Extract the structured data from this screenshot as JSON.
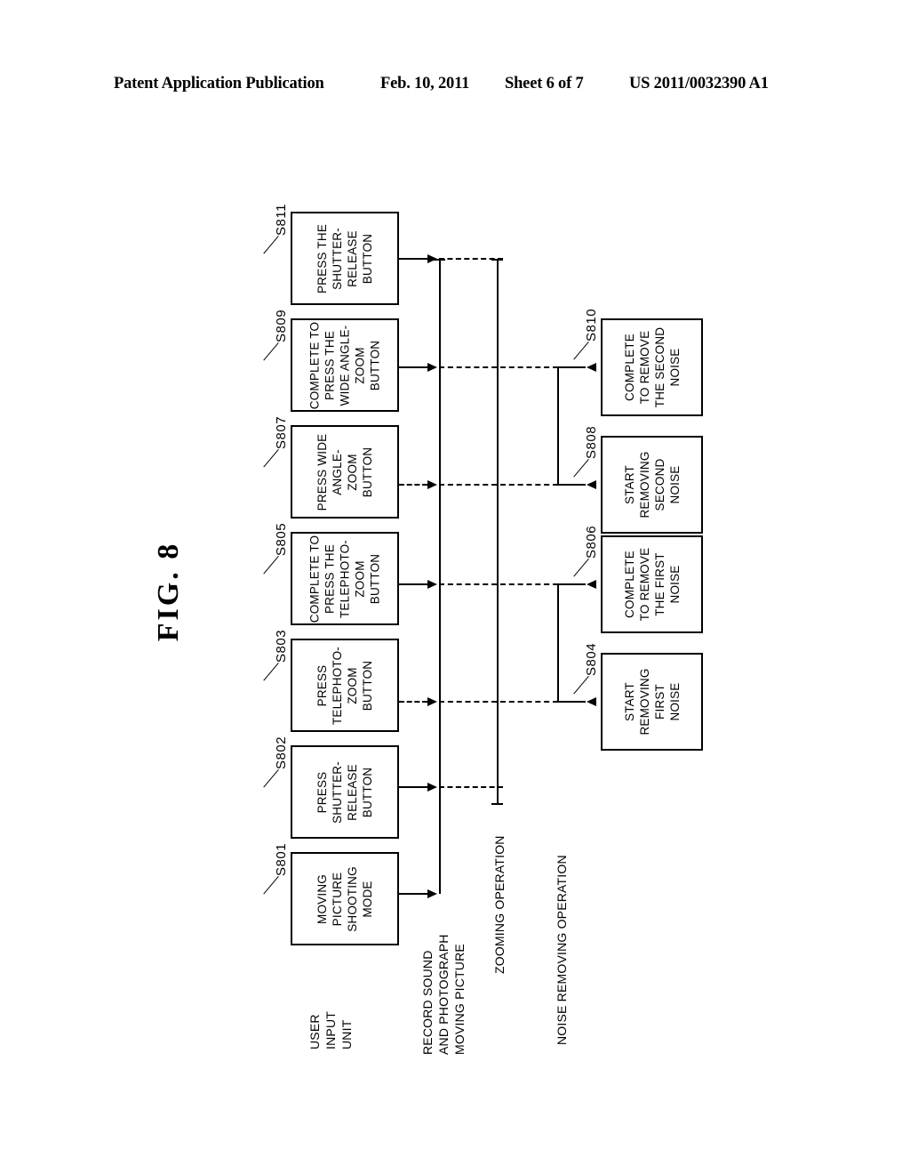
{
  "header": {
    "publication": "Patent Application Publication",
    "date": "Feb. 10, 2011",
    "sheet": "Sheet 6 of 7",
    "patent_number": "US 2011/0032390 A1"
  },
  "figure": {
    "title": "FIG.  8"
  },
  "diagram": {
    "lane_labels": [
      {
        "id": "user-input-unit",
        "text": "USER\nINPUT\nUNIT"
      },
      {
        "id": "record-sound",
        "text": "RECORD SOUND\nAND PHOTOGRAPH\nMOVING PICTURE"
      },
      {
        "id": "zooming-operation",
        "text": "ZOOMING OPERATION"
      },
      {
        "id": "noise-removing-operation",
        "text": "NOISE REMOVING OPERATION"
      }
    ],
    "left_nodes": [
      {
        "ref": "S801",
        "text": "MOVING\nPICTURE\nSHOOTING\nMODE"
      },
      {
        "ref": "S802",
        "text": "PRESS\nSHUTTER-\nRELEASE\nBUTTON"
      },
      {
        "ref": "S803",
        "text": "PRESS\nTELEPHOTO-\nZOOM\nBUTTON"
      },
      {
        "ref": "S805",
        "text": "COMPLETE TO\nPRESS THE\nTELEPHOTO-\nZOOM\nBUTTON"
      },
      {
        "ref": "S807",
        "text": "PRESS WIDE\nANGLE-\nZOOM\nBUTTON"
      },
      {
        "ref": "S809",
        "text": "COMPLETE TO\nPRESS THE\nWIDE ANGLE-\nZOOM\nBUTTON"
      },
      {
        "ref": "S811",
        "text": "PRESS THE\nSHUTTER-\nRELEASE\nBUTTON"
      }
    ],
    "right_nodes": [
      {
        "ref": "S804",
        "text": "START\nREMOVING\nFIRST\nNOISE"
      },
      {
        "ref": "S806",
        "text": "COMPLETE\nTO REMOVE\nTHE FIRST\nNOISE"
      },
      {
        "ref": "S808",
        "text": "START\nREMOVING\nSECOND\nNOISE"
      },
      {
        "ref": "S810",
        "text": "COMPLETE\nTO REMOVE\nTHE SECOND\nNOISE"
      }
    ]
  }
}
